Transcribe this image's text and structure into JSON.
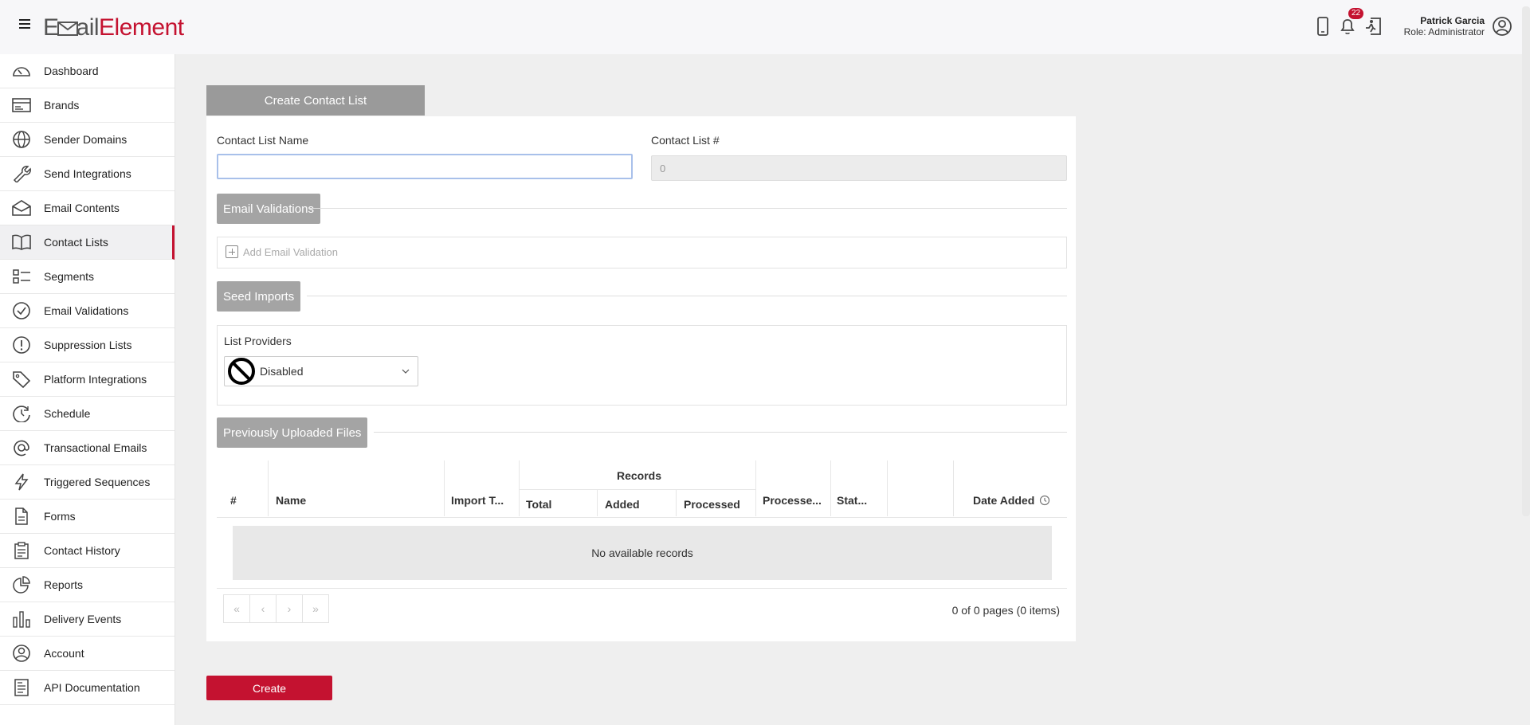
{
  "header": {
    "logo_left": "E",
    "logo_mid": "ail",
    "logo_right": "Element",
    "notification_count": "22",
    "user_name": "Patrick Garcia",
    "user_role": "Role: Administrator"
  },
  "sidebar": {
    "items": [
      {
        "label": "Dashboard",
        "icon": "gauge-icon"
      },
      {
        "label": "Brands",
        "icon": "card-icon"
      },
      {
        "label": "Sender Domains",
        "icon": "globe-icon"
      },
      {
        "label": "Send Integrations",
        "icon": "wrench-icon"
      },
      {
        "label": "Email Contents",
        "icon": "envelope-icon"
      },
      {
        "label": "Contact Lists",
        "icon": "book-icon"
      },
      {
        "label": "Segments",
        "icon": "list-icon"
      },
      {
        "label": "Email Validations",
        "icon": "check-circle-icon"
      },
      {
        "label": "Suppression Lists",
        "icon": "exclamation-circle-icon"
      },
      {
        "label": "Platform Integrations",
        "icon": "tag-icon"
      },
      {
        "label": "Schedule",
        "icon": "clock-arrow-icon"
      },
      {
        "label": "Transactional Emails",
        "icon": "at-icon"
      },
      {
        "label": "Triggered Sequences",
        "icon": "lightning-icon"
      },
      {
        "label": "Forms",
        "icon": "document-icon"
      },
      {
        "label": "Contact History",
        "icon": "clipboard-icon"
      },
      {
        "label": "Reports",
        "icon": "pie-chart-icon"
      },
      {
        "label": "Delivery Events",
        "icon": "bar-chart-icon"
      },
      {
        "label": "Account",
        "icon": "user-circle-icon"
      },
      {
        "label": "API Documentation",
        "icon": "api-doc-icon"
      }
    ],
    "active_index": 5
  },
  "form": {
    "tab_title": "Create Contact List",
    "name_label": "Contact List Name",
    "name_value": "",
    "number_label": "Contact List #",
    "number_value": "0",
    "email_validations_label": "Email Validations",
    "add_validation_label": "Add Email Validation",
    "seed_imports_label": "Seed Imports",
    "list_providers_label": "List Providers",
    "list_providers_value": "Disabled",
    "uploaded_files_label": "Previously Uploaded Files"
  },
  "table": {
    "headers": {
      "num": "#",
      "name": "Name",
      "import_type": "Import T...",
      "records": "Records",
      "total": "Total",
      "added": "Added",
      "processed": "Processed",
      "processed2": "Processe...",
      "status": "Stat...",
      "date_added": "Date Added"
    },
    "empty_text": "No available records",
    "pager_first": "«",
    "pager_prev": "‹",
    "pager_next": "›",
    "pager_last": "»",
    "pager_info": "0 of 0 pages (0 items)"
  },
  "actions": {
    "create_label": "Create"
  }
}
